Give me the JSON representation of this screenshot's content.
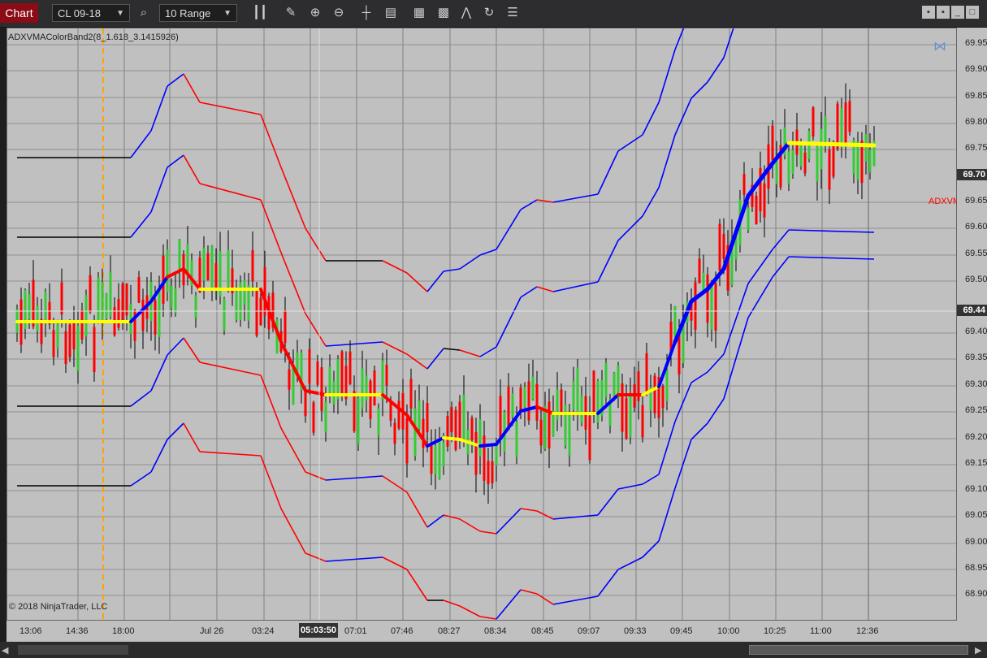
{
  "toolbar": {
    "chart_label": "Chart",
    "instrument": "CL 09-18",
    "bar_type": "10 Range",
    "icons": [
      "search-icon",
      "bar-style-icon",
      "pencil-icon",
      "zoom-in-icon",
      "zoom-out-icon",
      "crosshair-icon",
      "data-box-icon",
      "indicators-icon",
      "strategies-icon",
      "drawing-tools-icon",
      "refresh-icon",
      "properties-icon"
    ]
  },
  "indicator_label": "ADXVMAColorBand2(8_1.618_3.1415926)",
  "copyright": "© 2018 NinjaTrader, LLC",
  "right_indicator_tag": "ADXVM",
  "price_axis": {
    "labels": [
      "69.95",
      "69.90",
      "69.85",
      "69.80",
      "69.75",
      "69.65",
      "69.60",
      "69.55",
      "69.50",
      "69.40",
      "69.35",
      "69.30",
      "69.25",
      "69.20",
      "69.15",
      "69.10",
      "69.05",
      "69.00",
      "68.95",
      "68.90"
    ],
    "last_price": "69.70",
    "crosshair_price": "69.44"
  },
  "time_axis": {
    "labels": [
      "13:06",
      "14:36",
      "18:00",
      "Jul 26",
      "03:24",
      "07:01",
      "07:46",
      "08:27",
      "08:34",
      "08:45",
      "09:07",
      "09:33",
      "09:45",
      "10:00",
      "10:25",
      "11:00",
      "12:36"
    ],
    "crosshair_time": "05:03:50"
  },
  "colors": {
    "up_bar": "#33cc33",
    "down_bar": "#ff0000",
    "neutral_bar": "#000000",
    "trend_up": "#0000ff",
    "trend_down": "#ff0000",
    "trend_flat": "#ffff00",
    "band_flat": "#000000",
    "background": "#c0c0c0"
  }
}
